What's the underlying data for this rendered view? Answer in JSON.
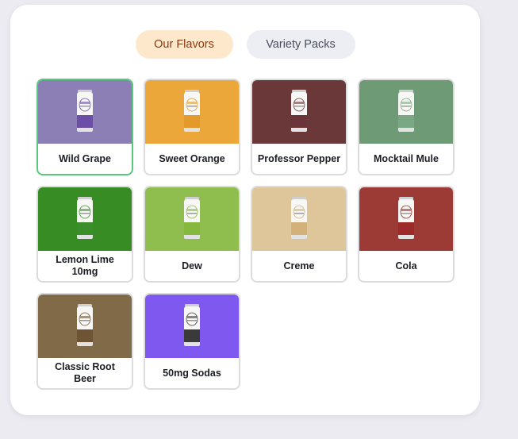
{
  "tabs": [
    {
      "label": "Our Flavors",
      "active": true
    },
    {
      "label": "Variety Packs",
      "active": false
    }
  ],
  "flavors": [
    {
      "label": "Wild Grape",
      "color": "#8b7fb5",
      "stripe": "#6b4fa6",
      "selected": true
    },
    {
      "label": "Sweet Orange",
      "color": "#eba73a",
      "stripe": "#e39a2a",
      "selected": false
    },
    {
      "label": "Professor Pepper",
      "color": "#6b383a",
      "stripe": "#6a3438",
      "selected": false
    },
    {
      "label": "Mocktail Mule",
      "color": "#6e9a76",
      "stripe": "#7aa882",
      "selected": false
    },
    {
      "label": "Lemon Lime 10mg",
      "color": "#378d23",
      "stripe": "#3a8f2a",
      "selected": false
    },
    {
      "label": "Dew",
      "color": "#8fbd4e",
      "stripe": "#86b83e",
      "selected": false
    },
    {
      "label": "Creme",
      "color": "#dfc59a",
      "stripe": "#d2b27a",
      "selected": false
    },
    {
      "label": "Cola",
      "color": "#9c3a35",
      "stripe": "#9c2a28",
      "selected": false
    },
    {
      "label": "Classic Root Beer",
      "color": "#806a48",
      "stripe": "#6e5434",
      "selected": false
    },
    {
      "label": "50mg Sodas",
      "color": "#7e58ef",
      "stripe": "#3a3a3a",
      "selected": false
    }
  ]
}
